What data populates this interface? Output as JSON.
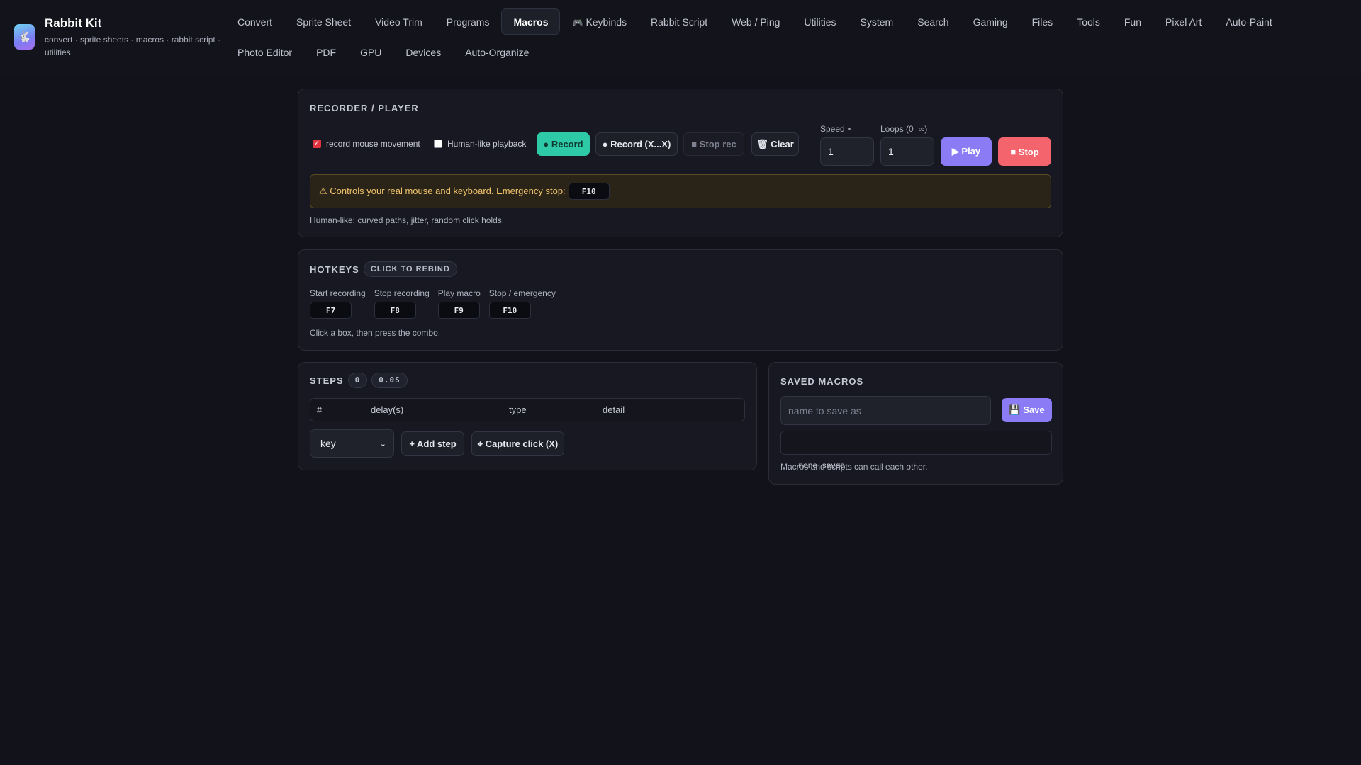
{
  "app": {
    "title": "Rabbit Kit",
    "subtitle": "convert · sprite sheets · macros · rabbit script · utilities"
  },
  "nav": {
    "active": "Macros",
    "items": [
      "Convert",
      "Sprite Sheet",
      "Video Trim",
      "Programs",
      "Macros",
      "Keybinds",
      "Rabbit Script",
      "Web / Ping",
      "Utilities",
      "System",
      "Search",
      "Gaming",
      "Files",
      "Tools",
      "Fun",
      "Pixel Art",
      "Auto-Paint",
      "Photo Editor",
      "PDF",
      "GPU",
      "Devices",
      "Auto-Organize"
    ]
  },
  "recorder": {
    "title": "Recorder / Player",
    "record_mouse_label": "record mouse movement",
    "record_mouse_checked": true,
    "humanlike_label": "Human-like playback",
    "humanlike_checked": false,
    "record_btn": "● Record",
    "record_xx_btn": "● Record (X...X)",
    "stop_rec_btn": "■ Stop rec",
    "clear_btn": "🗑 Clear",
    "speed_label": "Speed ×",
    "speed_value": "1",
    "loops_label": "Loops (0=∞)",
    "loops_value": "1",
    "play_btn": "▶ Play",
    "stop_btn": "■ Stop",
    "warning_text": "⚠ Controls your real mouse and keyboard. Emergency stop:",
    "warning_key": "F10",
    "note": "Human-like: curved paths, jitter, random click holds."
  },
  "hotkeys": {
    "title": "Hotkeys",
    "pill": "CLICK TO REBIND",
    "items": [
      {
        "label": "Start recording",
        "key": "F7"
      },
      {
        "label": "Stop recording",
        "key": "F8"
      },
      {
        "label": "Play macro",
        "key": "F9"
      },
      {
        "label": "Stop / emergency",
        "key": "F10"
      }
    ],
    "note": "Click a box, then press the combo."
  },
  "steps": {
    "title": "Steps",
    "count": "0",
    "duration": "0.0S",
    "columns": [
      "#",
      "delay(s)",
      "type",
      "detail"
    ],
    "type_select": "key",
    "add_step_btn": "+ Add step",
    "capture_btn": "⌖ Capture click (X)"
  },
  "saved": {
    "title": "Saved Macros",
    "name_placeholder": "name to save as",
    "save_btn": "💾 Save",
    "empty_text": "none  saved",
    "note": "Macros and scripts can call each other."
  },
  "colors": {
    "background": "#12131a",
    "accent_green": "#2ec9a7",
    "accent_purple": "#8b7cf6",
    "accent_red": "#f3646d",
    "warning_bg": "#2a2418",
    "warning_text": "#f2c46d"
  }
}
